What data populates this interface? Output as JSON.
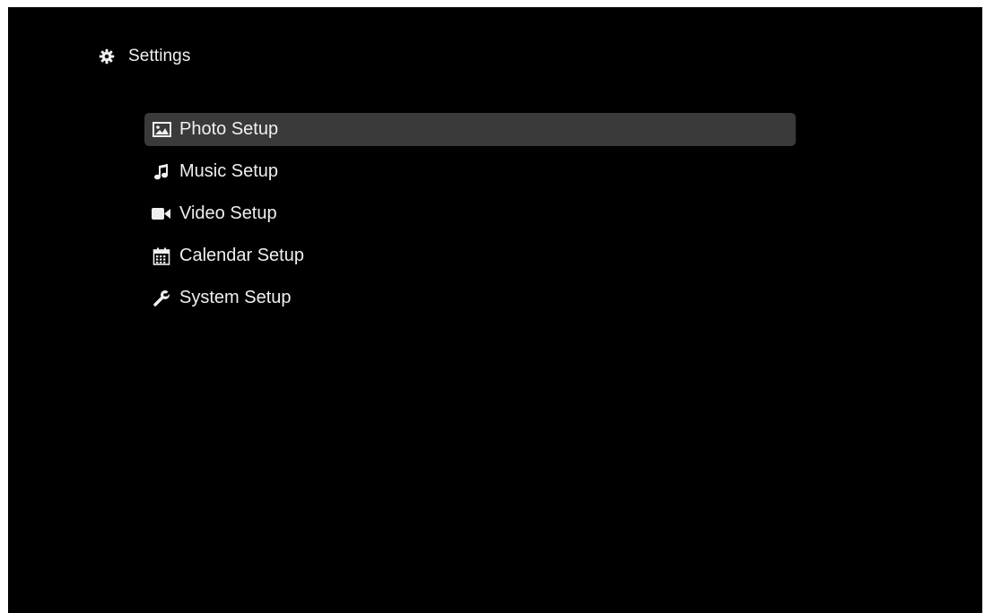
{
  "header": {
    "title": "Settings",
    "icon": "gear-icon"
  },
  "menu": {
    "selected_index": 0,
    "highlight_color": "#3a3a3a",
    "items": [
      {
        "label": "Photo Setup",
        "icon": "photo-icon"
      },
      {
        "label": "Music Setup",
        "icon": "music-note-icon"
      },
      {
        "label": "Video Setup",
        "icon": "video-camera-icon"
      },
      {
        "label": "Calendar Setup",
        "icon": "calendar-icon"
      },
      {
        "label": "System Setup",
        "icon": "wrench-icon"
      }
    ]
  }
}
